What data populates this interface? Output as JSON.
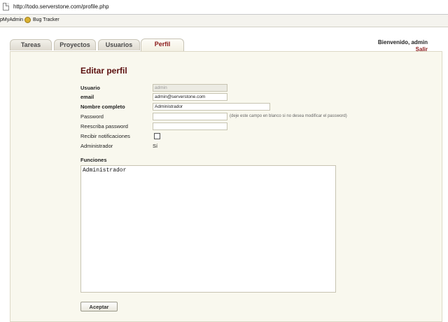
{
  "browser": {
    "url": "http://todo.serverstone.com/profile.php",
    "bookmarks": [
      {
        "label": "pMyAdmin"
      },
      {
        "label": "Bug Tracker"
      }
    ]
  },
  "nav": {
    "tabs": [
      {
        "label": "Tareas"
      },
      {
        "label": "Proyectos"
      },
      {
        "label": "Usuarios"
      },
      {
        "label": "Perfil",
        "active": true
      }
    ],
    "welcome": "Bienvenido, admin",
    "logout": "Salir"
  },
  "form": {
    "title": "Editar perfil",
    "usuario_label": "Usuario",
    "usuario_value": "admin",
    "email_label": "email",
    "email_value": "admin@serverstone.com",
    "nombre_label": "Nombre completo",
    "nombre_value": "Administrador",
    "password_label": "Password",
    "password_value": "",
    "password_hint": "(deje este campo en blanco si no desea modificar el password)",
    "repassword_label": "Reescriba password",
    "repassword_value": "",
    "notif_label": "Recibir notificaciones",
    "notif_checked": false,
    "admin_label": "Administrador",
    "admin_value": "Sí",
    "funciones_label": "Funciones",
    "funciones_value": "Administrador",
    "submit_label": "Aceptar"
  },
  "colors": {
    "accent": "#8b1a1a",
    "title": "#5b0f0f",
    "panel_bg": "#f9f8ee"
  }
}
